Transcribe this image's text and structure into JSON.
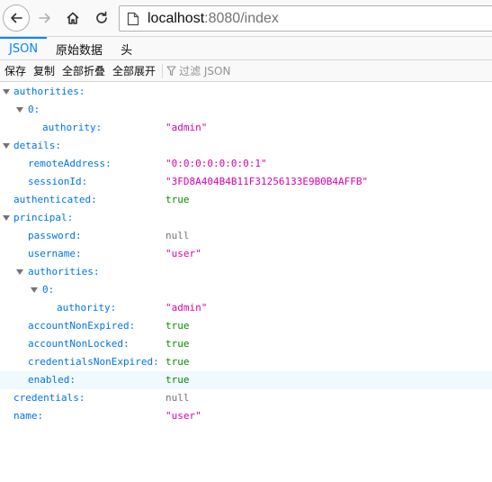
{
  "browser": {
    "url_host": "localhost",
    "url_rest": ":8080/index",
    "icons": [
      "back-arrow-icon",
      "forward-arrow-icon",
      "home-icon",
      "reload-icon",
      "page-icon"
    ]
  },
  "viewer": {
    "tabs": [
      {
        "label": "JSON",
        "active": true
      },
      {
        "label": "原始数据",
        "active": false
      },
      {
        "label": "头",
        "active": false
      }
    ],
    "toolbar": {
      "save": "保存",
      "copy": "复制",
      "collapse_all": "全部折叠",
      "expand_all": "全部展开",
      "filter_placeholder": "过滤 JSON"
    }
  },
  "json_tree": {
    "rows": [
      {
        "key": "authorities:",
        "value": ""
      },
      {
        "key": "0:",
        "value": ""
      },
      {
        "key": "authority:",
        "value": "\"admin\""
      },
      {
        "key": "details:",
        "value": ""
      },
      {
        "key": "remoteAddress:",
        "value": "\"0:0:0:0:0:0:0:1\""
      },
      {
        "key": "sessionId:",
        "value": "\"3FD8A404B4B11F31256133E9B0B4AFFB\""
      },
      {
        "key": "authenticated:",
        "value": "true"
      },
      {
        "key": "principal:",
        "value": ""
      },
      {
        "key": "password:",
        "value": "null"
      },
      {
        "key": "username:",
        "value": "\"user\""
      },
      {
        "key": "authorities:",
        "value": ""
      },
      {
        "key": "0:",
        "value": ""
      },
      {
        "key": "authority:",
        "value": "\"admin\""
      },
      {
        "key": "accountNonExpired:",
        "value": "true"
      },
      {
        "key": "accountNonLocked:",
        "value": "true"
      },
      {
        "key": "credentialsNonExpired:",
        "value": "true"
      },
      {
        "key": "enabled:",
        "value": "true"
      },
      {
        "key": "credentials:",
        "value": "null"
      },
      {
        "key": "name:",
        "value": "\"user\""
      }
    ]
  },
  "colors": {
    "key": "#0074e8",
    "string": "#dd00a9",
    "boolean": "#058b00",
    "null": "#737373",
    "accent": "#0a84ff"
  }
}
